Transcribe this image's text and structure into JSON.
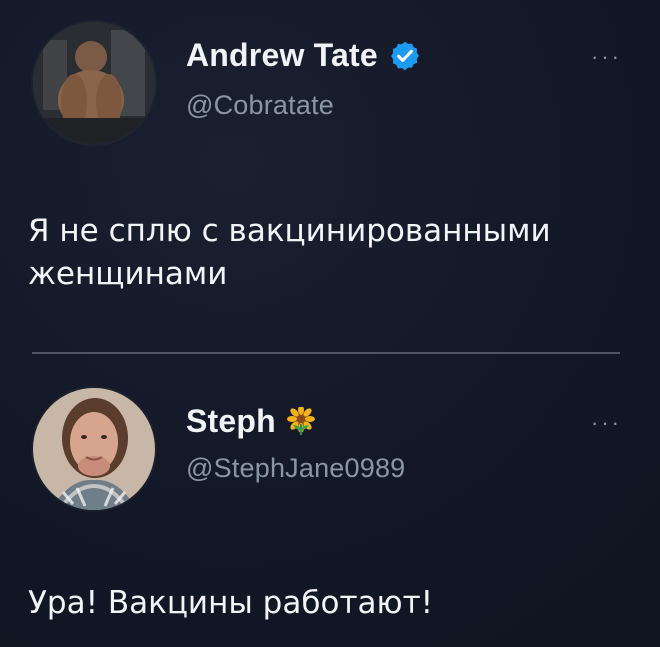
{
  "tweets": [
    {
      "name": "Andrew Tate",
      "handle": "@Cobratate",
      "text": "Я не сплю с вакцинированными женщинами",
      "more_label": "···",
      "badge_icon": "verified-check-icon",
      "badge_color": "#1d9bf0"
    },
    {
      "name": "Steph",
      "handle": "@StephJane0989",
      "text": "Ура! Вакцины работают!",
      "more_label": "···",
      "badge_icon": "sunflower-icon",
      "badge_color": "#f3b21b"
    }
  ],
  "theme": {
    "background": "#121826",
    "text": "#f2f4f8",
    "secondary_text": "#8b96a3",
    "divider": "#6f7782"
  }
}
